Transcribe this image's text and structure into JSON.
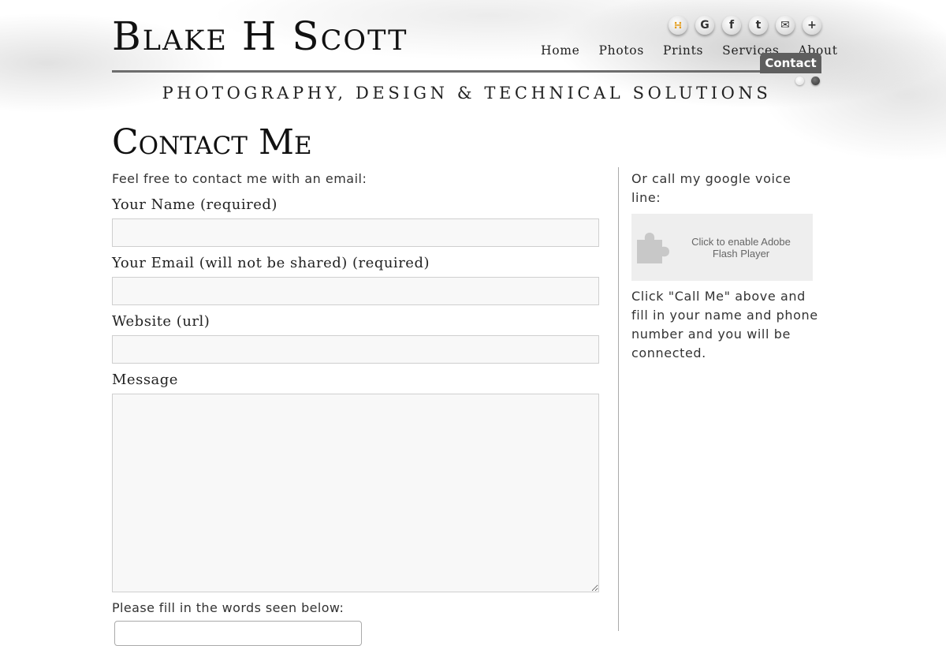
{
  "header": {
    "logo": "Blake H Scott",
    "tagline": "PHOTOGRAPHY, DESIGN & TECHNICAL SOLUTIONS",
    "social_icons": [
      "rss-icon",
      "google-icon",
      "facebook-icon",
      "twitter-icon",
      "email-icon",
      "plus-icon"
    ],
    "nav": {
      "home": "Home",
      "photos": "Photos",
      "prints": "Prints",
      "services": "Services",
      "about": "About",
      "contact": "Contact"
    }
  },
  "main": {
    "title": "Contact Me",
    "intro": "Feel free to contact me with an email:",
    "form": {
      "name_label": "Your Name (required)",
      "name_value": "",
      "email_label": "Your Email (will not be shared) (required)",
      "email_value": "",
      "website_label": "Website (url)",
      "website_value": "",
      "message_label": "Message",
      "message_value": "",
      "captcha_label": "Please fill in the words seen below:"
    }
  },
  "sidebar": {
    "call_text": "Or call my google voice line:",
    "flash_text": "Click to enable Adobe Flash Player",
    "instructions": "Click \"Call Me\" above and fill in your name and phone number and you will be connected."
  },
  "colors": {
    "rss": "#e39a16",
    "active_tab": "#5e5e5e",
    "rule": "#6d6d6d"
  }
}
